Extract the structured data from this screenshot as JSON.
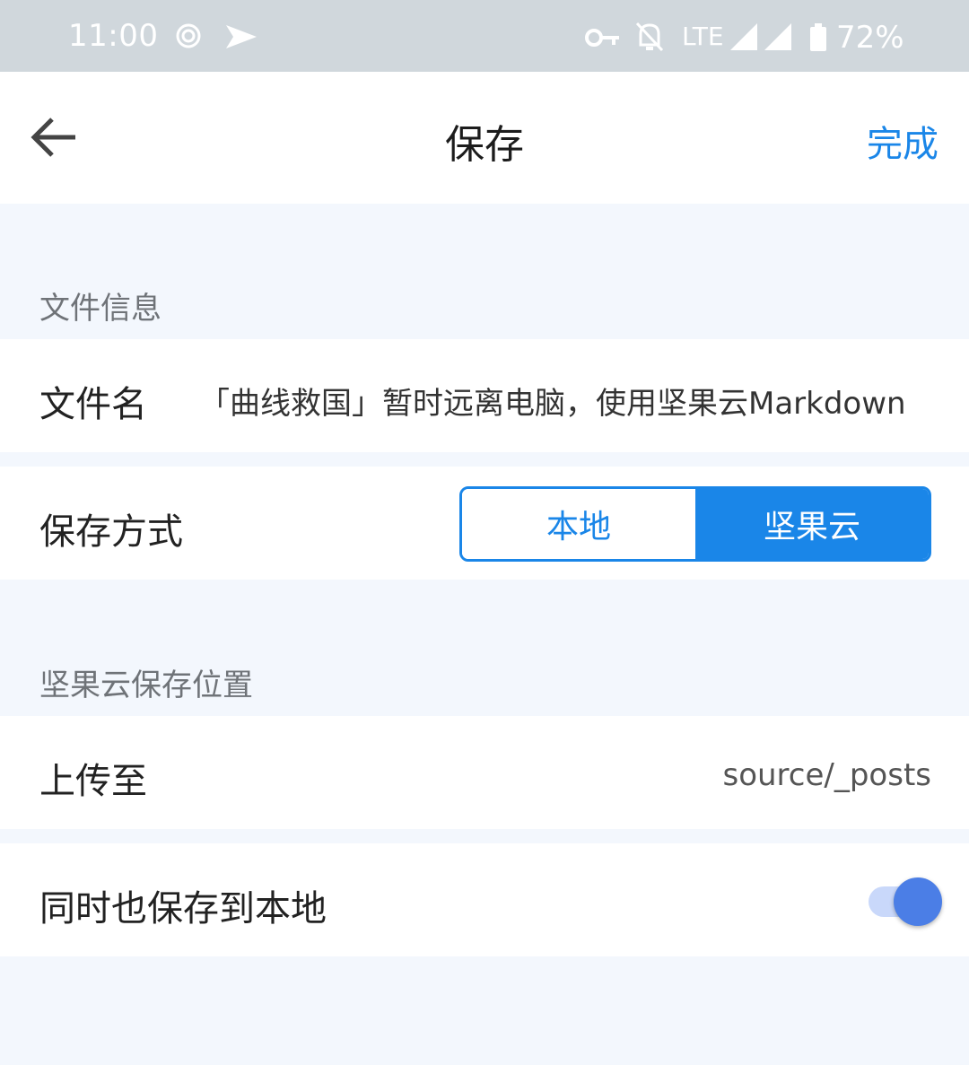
{
  "status_bar": {
    "time": "11:00",
    "network": "LTE",
    "battery": "72%",
    "icons": [
      "sync-icon",
      "send-icon",
      "vpn-key-icon",
      "notifications-off-icon",
      "signal-icon",
      "battery-icon"
    ]
  },
  "header": {
    "title": "保存",
    "done_label": "完成",
    "back_icon": "arrow-left-icon"
  },
  "file_info": {
    "section_title": "文件信息",
    "filename_label": "文件名",
    "filename_value": "「曲线救国」暂时远离电脑，使用坚果云Markdown"
  },
  "save_mode": {
    "label": "保存方式",
    "options": [
      "本地",
      "坚果云"
    ],
    "selected": "坚果云"
  },
  "cloud_location": {
    "section_title": "坚果云保存位置",
    "upload_label": "上传至",
    "upload_value": "source/_posts",
    "also_local_label": "同时也保存到本地",
    "also_local_enabled": true
  },
  "colors": {
    "accent": "#1a86e8",
    "background": "#f3f7fd",
    "status_bar": "#d0d7dc",
    "toggle_knob": "#4b7ee6"
  }
}
